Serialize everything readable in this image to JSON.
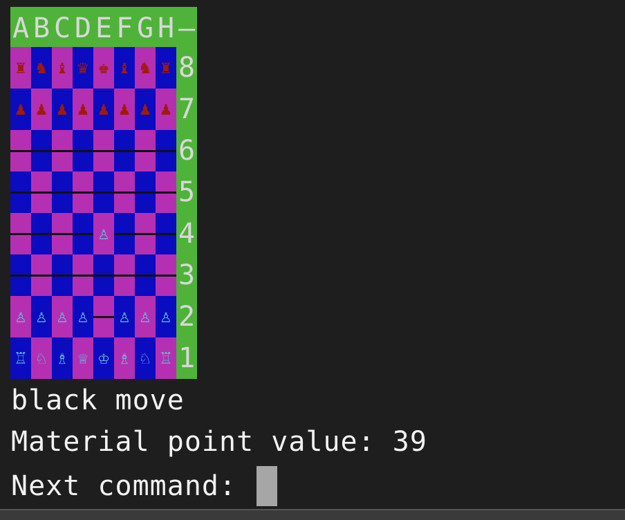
{
  "board": {
    "files": [
      "A",
      "B",
      "C",
      "D",
      "E",
      "F",
      "G",
      "H",
      "—"
    ],
    "ranks": [
      "8",
      "7",
      "6",
      "5",
      "4",
      "3",
      "2",
      "1"
    ],
    "squares": [
      [
        "♜",
        "♞",
        "♝",
        "♛",
        "♚",
        "♝",
        "♞",
        "♜"
      ],
      [
        "♟",
        "♟",
        "♟",
        "♟",
        "♟",
        "♟",
        "♟",
        "♟"
      ],
      [
        "",
        "",
        "",
        "",
        "",
        "",
        "",
        ""
      ],
      [
        "",
        "",
        "",
        "",
        "",
        "",
        "",
        ""
      ],
      [
        "",
        "",
        "",
        "",
        "♙",
        "",
        "",
        ""
      ],
      [
        "",
        "",
        "",
        "",
        "",
        "",
        "",
        ""
      ],
      [
        "♙",
        "♙",
        "♙",
        "♙",
        "",
        "♙",
        "♙",
        "♙"
      ],
      [
        "♖",
        "♘",
        "♗",
        "♕",
        "♔",
        "♗",
        "♘",
        "♖"
      ]
    ]
  },
  "terminal": {
    "turn_line": "black move",
    "material_line": "Material point value: 39",
    "prompt": "Next command: "
  },
  "colors": {
    "board_frame": "#4fb33a",
    "light_square": "#b52fb3",
    "dark_square": "#0b0bbf",
    "black_piece": "#a01a0a",
    "white_piece": "#5fc5d5",
    "background": "#1e1e1e"
  }
}
